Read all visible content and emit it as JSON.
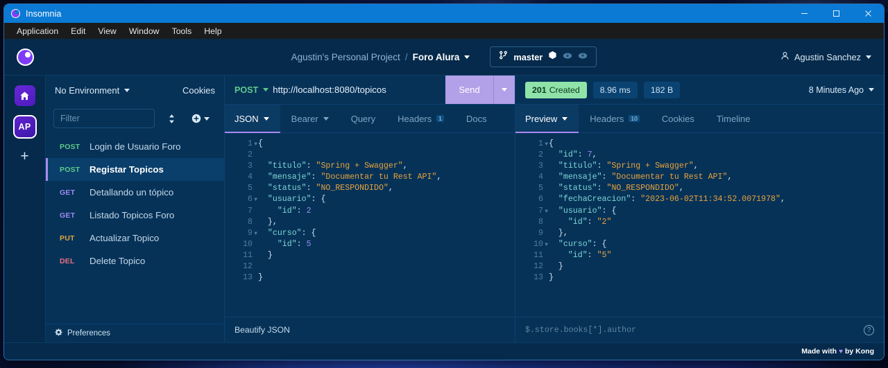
{
  "titlebar": {
    "app_name": "Insomnia",
    "minimize": "minimize-button",
    "maximize": "maximize-button",
    "close": "close-button"
  },
  "menubar": {
    "items": [
      {
        "label": "Application"
      },
      {
        "label": "Edit"
      },
      {
        "label": "View"
      },
      {
        "label": "Window"
      },
      {
        "label": "Tools"
      },
      {
        "label": "Help"
      }
    ]
  },
  "header": {
    "project_name": "Agustin's Personal Project",
    "separator": "/",
    "workspace_name": "Foro Alura",
    "branch_name": "master",
    "user_name": "Agustin Sanchez"
  },
  "rail": {
    "home_label": "home-icon",
    "project_initials": "AP",
    "add_label": "+"
  },
  "sidebar": {
    "environment_label": "No Environment",
    "cookies_label": "Cookies",
    "filter_placeholder": "Filter",
    "requests": [
      {
        "method": "POST",
        "name": "Login de Usuario Foro",
        "selected": false
      },
      {
        "method": "POST",
        "name": "Registar Topicos",
        "selected": true
      },
      {
        "method": "GET",
        "name": "Detallando un tópico",
        "selected": false
      },
      {
        "method": "GET",
        "name": "Listado Topicos Foro",
        "selected": false
      },
      {
        "method": "PUT",
        "name": "Actualizar Topico",
        "selected": false
      },
      {
        "method": "DEL",
        "name": "Delete Topico",
        "selected": false
      }
    ],
    "preferences_label": "Preferences"
  },
  "request_pane": {
    "method": "POST",
    "url": "http://localhost:8080/topicos",
    "send_label": "Send",
    "tabs": [
      {
        "label": "JSON",
        "badge": "",
        "active": true,
        "has_caret": true
      },
      {
        "label": "Bearer",
        "badge": "",
        "active": false,
        "has_caret": true
      },
      {
        "label": "Query",
        "badge": "",
        "active": false,
        "has_caret": false
      },
      {
        "label": "Headers",
        "badge": "1",
        "active": false,
        "has_caret": false
      },
      {
        "label": "Docs",
        "badge": "",
        "active": false,
        "has_caret": false
      }
    ],
    "body_lines": [
      {
        "num": "1",
        "fold": true,
        "tokens": [
          {
            "t": "p",
            "v": "{"
          }
        ]
      },
      {
        "num": "2",
        "fold": false,
        "tokens": []
      },
      {
        "num": "3",
        "fold": false,
        "tokens": [
          {
            "t": "k",
            "v": "  \"titulo\""
          },
          {
            "t": "p",
            "v": ": "
          },
          {
            "t": "s",
            "v": "\"Spring + Swagger\""
          },
          {
            "t": "p",
            "v": ","
          }
        ]
      },
      {
        "num": "4",
        "fold": false,
        "tokens": [
          {
            "t": "k",
            "v": "  \"mensaje\""
          },
          {
            "t": "p",
            "v": ": "
          },
          {
            "t": "s",
            "v": "\"Documentar tu Rest API\""
          },
          {
            "t": "p",
            "v": ","
          }
        ]
      },
      {
        "num": "5",
        "fold": false,
        "tokens": [
          {
            "t": "k",
            "v": "  \"status\""
          },
          {
            "t": "p",
            "v": ": "
          },
          {
            "t": "s",
            "v": "\"NO_RESPONDIDO\""
          },
          {
            "t": "p",
            "v": ","
          }
        ]
      },
      {
        "num": "6",
        "fold": true,
        "tokens": [
          {
            "t": "k",
            "v": "  \"usuario\""
          },
          {
            "t": "p",
            "v": ": {"
          }
        ]
      },
      {
        "num": "7",
        "fold": false,
        "tokens": [
          {
            "t": "k",
            "v": "    \"id\""
          },
          {
            "t": "p",
            "v": ": "
          },
          {
            "t": "n",
            "v": "2"
          }
        ]
      },
      {
        "num": "8",
        "fold": false,
        "tokens": [
          {
            "t": "p",
            "v": "  },"
          }
        ]
      },
      {
        "num": "9",
        "fold": true,
        "tokens": [
          {
            "t": "k",
            "v": "  \"curso\""
          },
          {
            "t": "p",
            "v": ": {"
          }
        ]
      },
      {
        "num": "10",
        "fold": false,
        "tokens": [
          {
            "t": "k",
            "v": "    \"id\""
          },
          {
            "t": "p",
            "v": ": "
          },
          {
            "t": "n",
            "v": "5"
          }
        ]
      },
      {
        "num": "11",
        "fold": false,
        "tokens": [
          {
            "t": "p",
            "v": "  }"
          }
        ]
      },
      {
        "num": "12",
        "fold": false,
        "tokens": []
      },
      {
        "num": "13",
        "fold": false,
        "tokens": [
          {
            "t": "p",
            "v": "}"
          }
        ]
      }
    ],
    "beautify_label": "Beautify JSON"
  },
  "response_pane": {
    "status_code": "201",
    "status_text": "Created",
    "duration": "8.96 ms",
    "size": "182 B",
    "time_ago": "8 Minutes Ago",
    "tabs": [
      {
        "label": "Preview",
        "badge": "",
        "active": true,
        "has_caret": true
      },
      {
        "label": "Headers",
        "badge": "10",
        "active": false,
        "has_caret": false
      },
      {
        "label": "Cookies",
        "badge": "",
        "active": false,
        "has_caret": false
      },
      {
        "label": "Timeline",
        "badge": "",
        "active": false,
        "has_caret": false
      }
    ],
    "body_lines": [
      {
        "num": "1",
        "fold": true,
        "tokens": [
          {
            "t": "p",
            "v": "{"
          }
        ]
      },
      {
        "num": "2",
        "fold": false,
        "tokens": [
          {
            "t": "k",
            "v": "  \"id\""
          },
          {
            "t": "p",
            "v": ": "
          },
          {
            "t": "n",
            "v": "7"
          },
          {
            "t": "p",
            "v": ","
          }
        ]
      },
      {
        "num": "3",
        "fold": false,
        "tokens": [
          {
            "t": "k",
            "v": "  \"titulo\""
          },
          {
            "t": "p",
            "v": ": "
          },
          {
            "t": "s",
            "v": "\"Spring + Swagger\""
          },
          {
            "t": "p",
            "v": ","
          }
        ]
      },
      {
        "num": "4",
        "fold": false,
        "tokens": [
          {
            "t": "k",
            "v": "  \"mensaje\""
          },
          {
            "t": "p",
            "v": ": "
          },
          {
            "t": "s",
            "v": "\"Documentar tu Rest API\""
          },
          {
            "t": "p",
            "v": ","
          }
        ]
      },
      {
        "num": "5",
        "fold": false,
        "tokens": [
          {
            "t": "k",
            "v": "  \"status\""
          },
          {
            "t": "p",
            "v": ": "
          },
          {
            "t": "s",
            "v": "\"NO_RESPONDIDO\""
          },
          {
            "t": "p",
            "v": ","
          }
        ]
      },
      {
        "num": "6",
        "fold": false,
        "tokens": [
          {
            "t": "k",
            "v": "  \"fechaCreacion\""
          },
          {
            "t": "p",
            "v": ": "
          },
          {
            "t": "s",
            "v": "\"2023-06-02T11:34:52.0071978\""
          },
          {
            "t": "p",
            "v": ","
          }
        ]
      },
      {
        "num": "7",
        "fold": true,
        "tokens": [
          {
            "t": "k",
            "v": "  \"usuario\""
          },
          {
            "t": "p",
            "v": ": {"
          }
        ]
      },
      {
        "num": "8",
        "fold": false,
        "tokens": [
          {
            "t": "k",
            "v": "    \"id\""
          },
          {
            "t": "p",
            "v": ": "
          },
          {
            "t": "s",
            "v": "\"2\""
          }
        ]
      },
      {
        "num": "9",
        "fold": false,
        "tokens": [
          {
            "t": "p",
            "v": "  },"
          }
        ]
      },
      {
        "num": "10",
        "fold": true,
        "tokens": [
          {
            "t": "k",
            "v": "  \"curso\""
          },
          {
            "t": "p",
            "v": ": {"
          }
        ]
      },
      {
        "num": "11",
        "fold": false,
        "tokens": [
          {
            "t": "k",
            "v": "    \"id\""
          },
          {
            "t": "p",
            "v": ": "
          },
          {
            "t": "s",
            "v": "\"5\""
          }
        ]
      },
      {
        "num": "12",
        "fold": false,
        "tokens": [
          {
            "t": "p",
            "v": "  }"
          }
        ]
      },
      {
        "num": "13",
        "fold": false,
        "tokens": [
          {
            "t": "p",
            "v": "}"
          }
        ]
      }
    ],
    "filter_placeholder": "$.store.books[*].author",
    "help_label": "?"
  },
  "footer": {
    "made_with_prefix": "Made with",
    "made_with_suffix": "by Kong",
    "heart": "♥"
  },
  "colors": {
    "titlebar": "#0a7ad4",
    "app_background": "#063258",
    "header": "#052a4b",
    "accent_purple": "#a98cf0",
    "send_button": "#b2a0e8",
    "status_ok": "#90e3a8",
    "method_post": "#5fc98a",
    "method_get": "#9b8cf0",
    "method_put": "#e0a53c",
    "method_del": "#e8707f",
    "json_key": "#7fd7d4",
    "json_string": "#e8a33d",
    "json_number": "#9b8cf0"
  }
}
